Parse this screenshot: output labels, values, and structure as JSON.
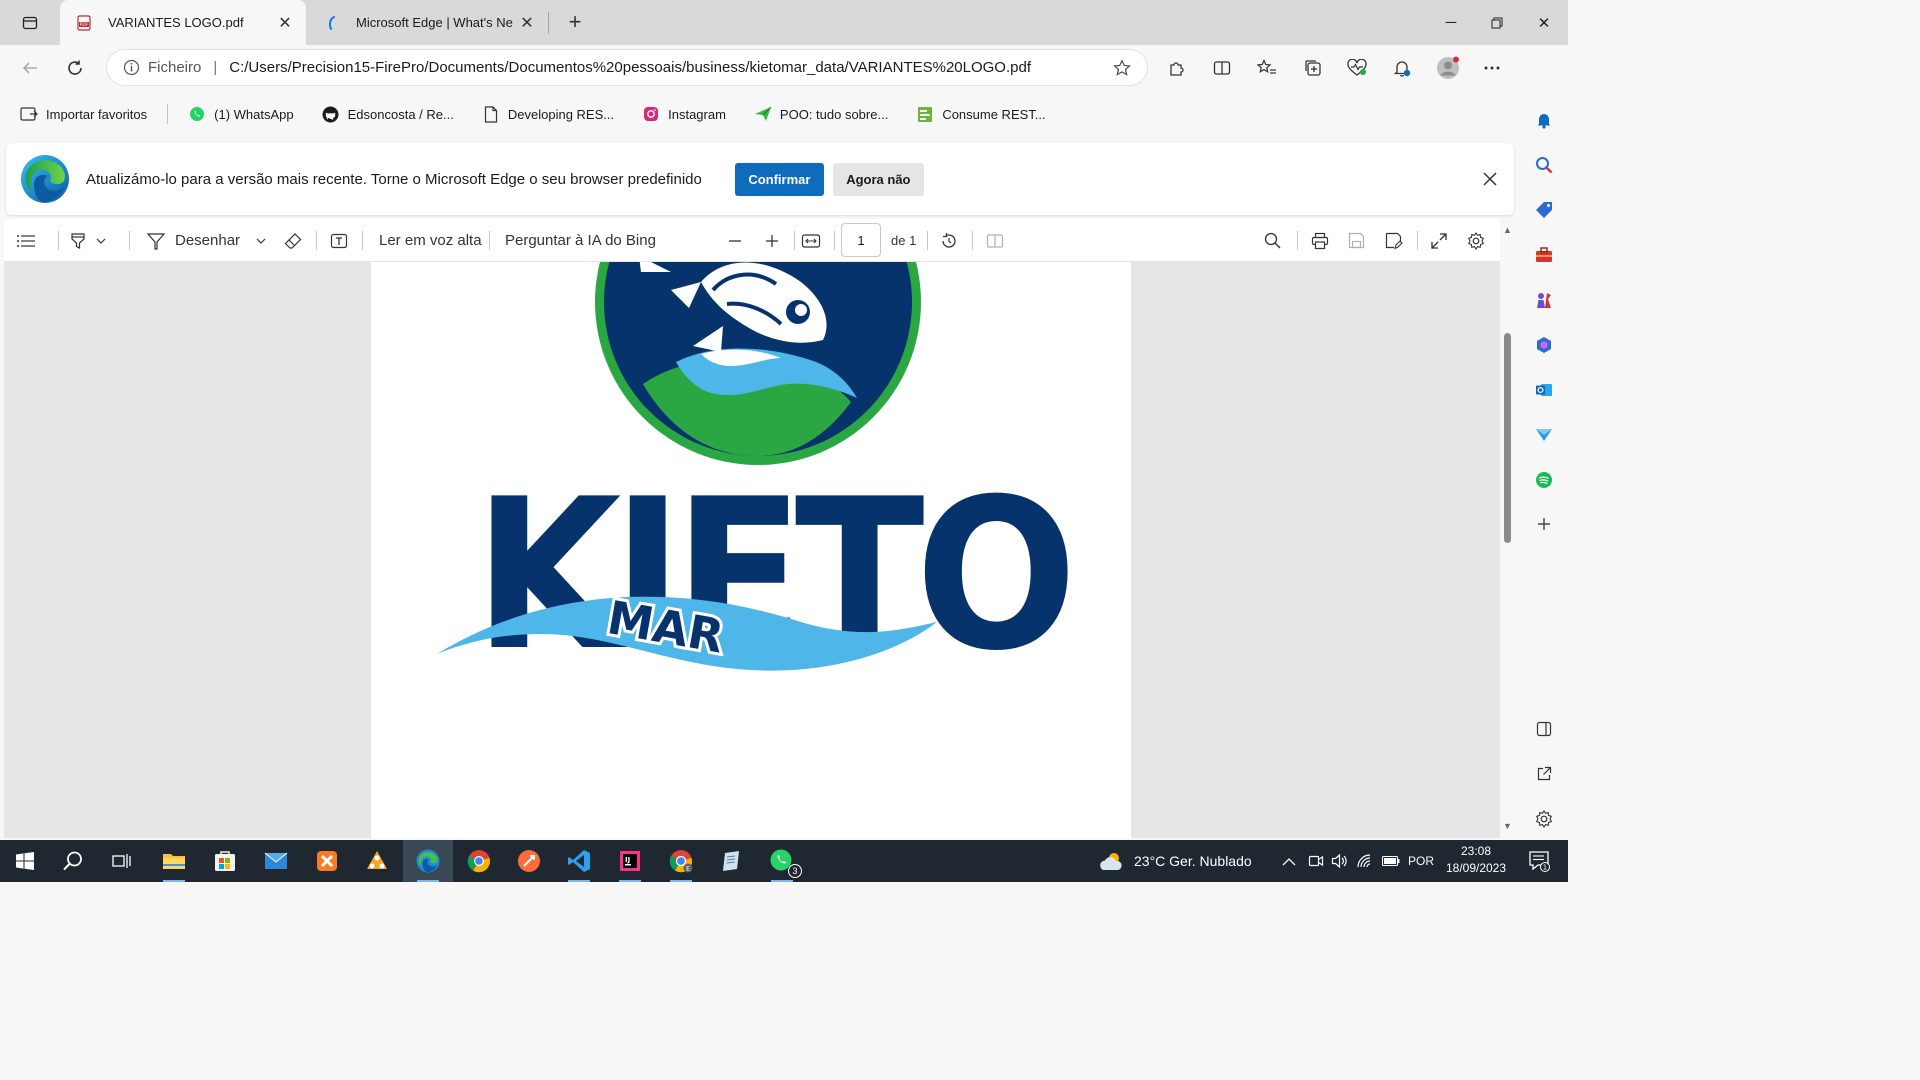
{
  "tabs": [
    {
      "title": "VARIANTES LOGO.pdf",
      "icon": "pdf-icon",
      "active": true
    },
    {
      "title": "Microsoft Edge | What's Ne",
      "icon": "edge-whatsnew-icon",
      "active": false
    }
  ],
  "address": {
    "site_label": "Ficheiro",
    "url": "C:/Users/Precision15-FirePro/Documents/Documentos%20pessoais/business/kietomar_data/VARIANTES%20LOGO.pdf"
  },
  "bookmarks": [
    {
      "label": "Importar favoritos",
      "icon": "import-icon"
    },
    {
      "label": "(1) WhatsApp",
      "icon": "whatsapp-icon"
    },
    {
      "label": "Edsoncosta / Re...",
      "icon": "github-icon"
    },
    {
      "label": "Developing RES...",
      "icon": "page-icon"
    },
    {
      "label": "Instagram",
      "icon": "instagram-icon"
    },
    {
      "label": "POO: tudo sobre...",
      "icon": "arrow-icon"
    },
    {
      "label": "Consume REST...",
      "icon": "spring-icon"
    }
  ],
  "infobar": {
    "message": "Atualizámo-lo para a versão mais recente. Torne o Microsoft Edge o seu browser predefinido",
    "confirm_label": "Confirmar",
    "dismiss_label": "Agora não"
  },
  "pdf_toolbar": {
    "draw_label": "Desenhar",
    "read_aloud_label": "Ler em voz alta",
    "ask_ai_label": "Perguntar à IA do Bing",
    "page_value": "1",
    "page_total": "de 1"
  },
  "logo": {
    "word": "KIETO",
    "sub": "MAR"
  },
  "taskbar": {
    "weather": "23°C  Ger. Nublado",
    "language": "POR",
    "time": "23:08",
    "date": "18/09/2023",
    "whatsapp_badge": "3",
    "notif_badge": "1"
  },
  "colors": {
    "accent": "#0f6cbd",
    "logo_navy": "#06336b",
    "logo_green": "#2aa742",
    "logo_blue": "#4eb6e8"
  }
}
